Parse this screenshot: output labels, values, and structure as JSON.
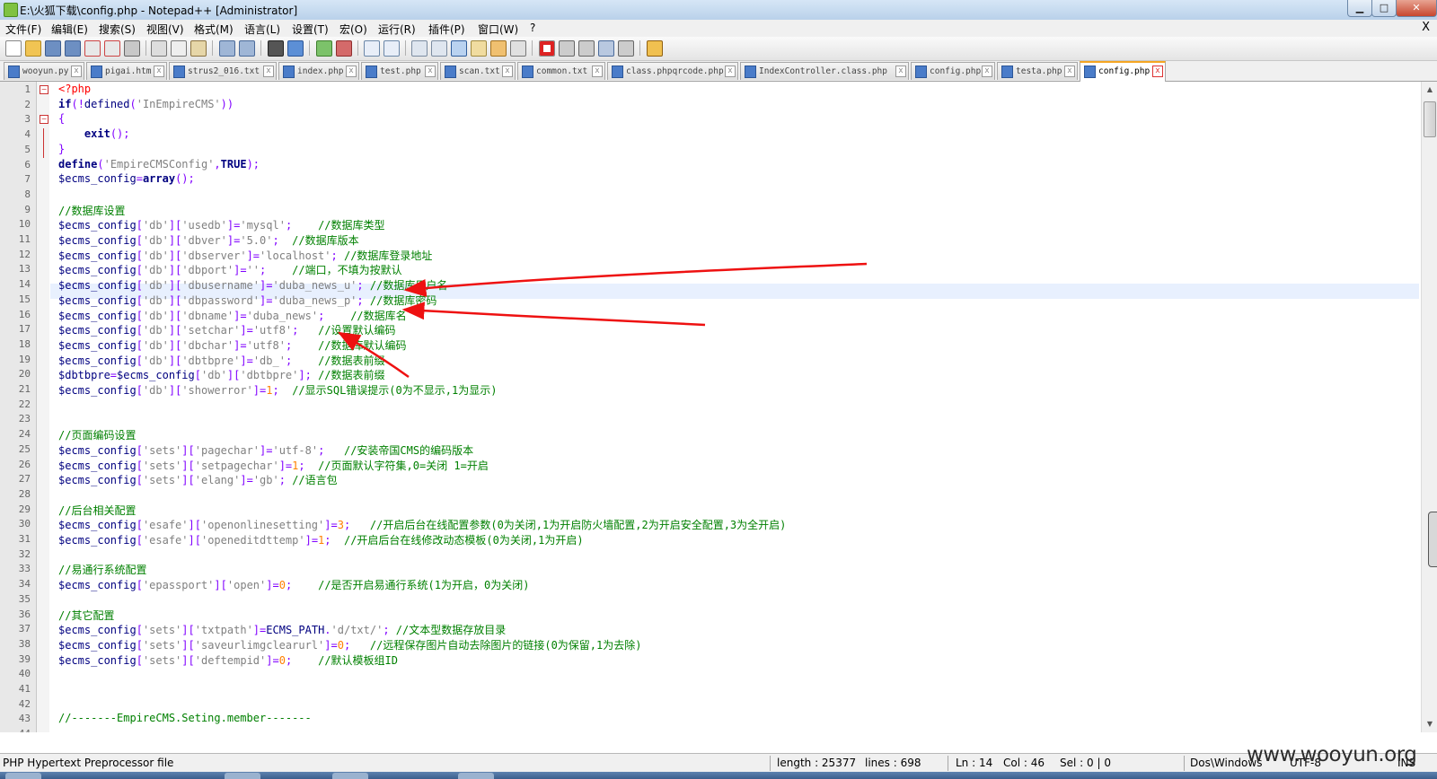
{
  "window": {
    "title": "E:\\火狐下载\\config.php - Notepad++ [Administrator]",
    "min_glyph": "▁",
    "max_glyph": "□",
    "close_glyph": "✕"
  },
  "menu": {
    "items": [
      "文件(F)",
      "编辑(E)",
      "搜索(S)",
      "视图(V)",
      "格式(M)",
      "语言(L)",
      "设置(T)",
      "宏(O)",
      "运行(R)",
      "插件(P)",
      "窗口(W)",
      "?"
    ],
    "close_glyph": "X"
  },
  "toolbar": {
    "icons": [
      "new-file-icon",
      "open-file-icon",
      "save-icon",
      "save-all-icon",
      "close-icon",
      "close-all-icon",
      "print-icon",
      "cut-icon",
      "copy-icon",
      "paste-icon",
      "undo-icon",
      "redo-icon",
      "find-icon",
      "replace-icon",
      "zoom-in-icon",
      "zoom-out-icon",
      "sync-v-icon",
      "sync-h-icon",
      "word-wrap-icon",
      "all-chars-icon",
      "indent-guide-icon",
      "udl-icon",
      "doc-map-icon",
      "function-list-icon",
      "record-macro-icon",
      "stop-macro-icon",
      "play-macro-icon",
      "run-macro-icon",
      "save-macro-icon",
      "plugin-icon"
    ]
  },
  "tabs": [
    {
      "label": "wooyun.py",
      "active": false
    },
    {
      "label": "pigai.htm",
      "active": false
    },
    {
      "label": "strus2_016.txt",
      "active": false
    },
    {
      "label": "index.php",
      "active": false
    },
    {
      "label": "test.php",
      "active": false
    },
    {
      "label": "scan.txt",
      "active": false
    },
    {
      "label": "common.txt",
      "active": false
    },
    {
      "label": "class.phpqrcode.php",
      "active": false
    },
    {
      "label": "IndexController.class.php",
      "active": false
    },
    {
      "label": "config.php",
      "active": false
    },
    {
      "label": "testa.php",
      "active": false
    },
    {
      "label": "config.php",
      "active": true
    }
  ],
  "editor": {
    "current_line": 14,
    "lines": [
      "<?php",
      "if(!defined('InEmpireCMS'))",
      "{",
      "    exit();",
      "}",
      "define('EmpireCMSConfig',TRUE);",
      "$ecms_config=array();",
      "",
      "//数据库设置",
      "$ecms_config['db']['usedb']='mysql';    //数据库类型",
      "$ecms_config['db']['dbver']='5.0';  //数据库版本",
      "$ecms_config['db']['dbserver']='localhost'; //数据库登录地址",
      "$ecms_config['db']['dbport']='';    //端口，不填为按默认",
      "$ecms_config['db']['dbusername']='duba_news_u'; //数据库用户名",
      "$ecms_config['db']['dbpassword']='duba_news_p'; //数据库密码",
      "$ecms_config['db']['dbname']='duba_news';    //数据库名",
      "$ecms_config['db']['setchar']='utf8';   //设置默认编码",
      "$ecms_config['db']['dbchar']='utf8';    //数据库默认编码",
      "$ecms_config['db']['dbtbpre']='db_';    //数据表前缀",
      "$dbtbpre=$ecms_config['db']['dbtbpre']; //数据表前缀",
      "$ecms_config['db']['showerror']=1;  //显示SQL错误提示(0为不显示,1为显示)",
      "",
      "",
      "//页面编码设置",
      "$ecms_config['sets']['pagechar']='utf-8';   //安装帝国CMS的编码版本",
      "$ecms_config['sets']['setpagechar']=1;  //页面默认字符集,0=关闭 1=开启",
      "$ecms_config['sets']['elang']='gb'; //语言包",
      "",
      "//后台相关配置",
      "$ecms_config['esafe']['openonlinesetting']=3;   //开启后台在线配置参数(0为关闭,1为开启防火墙配置,2为开启安全配置,3为全开启)",
      "$ecms_config['esafe']['openeditdttemp']=1;  //开启后台在线修改动态模板(0为关闭,1为开启)",
      "",
      "//易通行系统配置",
      "$ecms_config['epassport']['open']=0;    //是否开启易通行系统(1为开启，0为关闭)",
      "",
      "//其它配置",
      "$ecms_config['sets']['txtpath']=ECMS_PATH.'d/txt/'; //文本型数据存放目录",
      "$ecms_config['sets']['saveurlimgclearurl']=0;   //远程保存图片自动去除图片的链接(0为保留,1为去除)",
      "$ecms_config['sets']['deftempid']=0;    //默认模板组ID",
      "",
      "",
      "",
      "//-------EmpireCMS.Seting.member-------",
      ""
    ]
  },
  "status": {
    "file_type": "PHP Hypertext Preprocessor file",
    "length": "length : 25377",
    "lines": "lines : 698",
    "ln": "Ln : 14",
    "col": "Col : 46",
    "sel": "Sel : 0 | 0",
    "eol": "Dos\\Windows",
    "encoding": "UTF-8",
    "mode": "INS"
  },
  "watermark": "www.wooyun.org",
  "colors": {
    "keyword": "#000080",
    "string": "#808080",
    "comment": "#008000",
    "number": "#ff8000",
    "operator": "#8000ff",
    "php_tag": "#ff0000",
    "arrow": "#ee1111"
  }
}
